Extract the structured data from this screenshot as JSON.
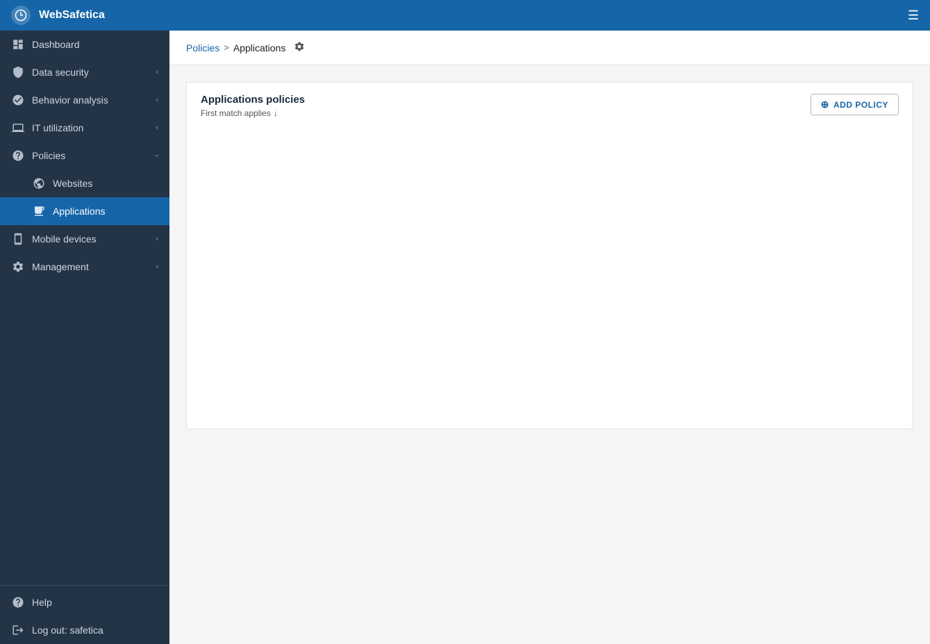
{
  "app": {
    "title": "WebSafetica",
    "menu_icon": "☰"
  },
  "sidebar": {
    "items": [
      {
        "id": "dashboard",
        "label": "Dashboard",
        "icon": "dashboard",
        "has_chevron": false,
        "active": false
      },
      {
        "id": "data-security",
        "label": "Data security",
        "icon": "data-security",
        "has_chevron": true,
        "active": false
      },
      {
        "id": "behavior-analysis",
        "label": "Behavior analysis",
        "icon": "behavior-analysis",
        "has_chevron": true,
        "active": false
      },
      {
        "id": "it-utilization",
        "label": "IT utilization",
        "icon": "it-utilization",
        "has_chevron": true,
        "active": false
      },
      {
        "id": "policies",
        "label": "Policies",
        "icon": "policies",
        "has_chevron": true,
        "chevron_down": true,
        "active": false
      },
      {
        "id": "websites",
        "label": "Websites",
        "icon": "websites",
        "has_chevron": false,
        "active": false,
        "indent": true
      },
      {
        "id": "applications",
        "label": "Applications",
        "icon": "applications",
        "has_chevron": false,
        "active": true,
        "indent": true
      },
      {
        "id": "mobile-devices",
        "label": "Mobile devices",
        "icon": "mobile-devices",
        "has_chevron": true,
        "active": false
      },
      {
        "id": "management",
        "label": "Management",
        "icon": "management",
        "has_chevron": true,
        "active": false
      }
    ],
    "bottom_items": [
      {
        "id": "help",
        "label": "Help",
        "icon": "help"
      },
      {
        "id": "logout",
        "label": "Log out: safetica",
        "icon": "logout"
      }
    ]
  },
  "breadcrumb": {
    "parent_label": "Policies",
    "separator": ">",
    "current_label": "Applications"
  },
  "main": {
    "card_title": "Applications policies",
    "first_match_label": "First match applies",
    "add_policy_label": "ADD POLICY"
  }
}
